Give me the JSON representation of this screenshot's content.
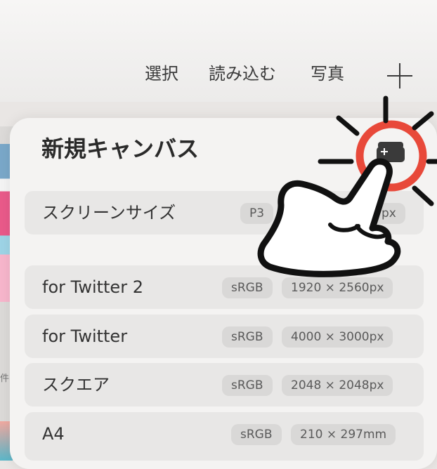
{
  "topbar": {
    "select_label": "選択",
    "import_label": "読み込む",
    "photo_label": "写真",
    "add_icon": "plus-icon"
  },
  "gallery": {
    "partial_label": "件"
  },
  "panel": {
    "title": "新規キャンバス",
    "create_icon": "new-canvas-icon",
    "screen_size": {
      "name": "スクリーンサイズ",
      "color_profile": "P3",
      "dimensions": "px"
    },
    "presets": [
      {
        "name": "for Twitter 2",
        "color_profile": "sRGB",
        "dimensions": "1920 × 2560px"
      },
      {
        "name": "for Twitter",
        "color_profile": "sRGB",
        "dimensions": "4000 × 3000px"
      },
      {
        "name": "スクエア",
        "color_profile": "sRGB",
        "dimensions": "2048 × 2048px"
      },
      {
        "name": "A4",
        "color_profile": "sRGB",
        "dimensions": "210 × 297mm"
      }
    ]
  },
  "overlay": {
    "pointer_icon": "pointing-hand-icon",
    "highlight_color": "#e8493a"
  }
}
